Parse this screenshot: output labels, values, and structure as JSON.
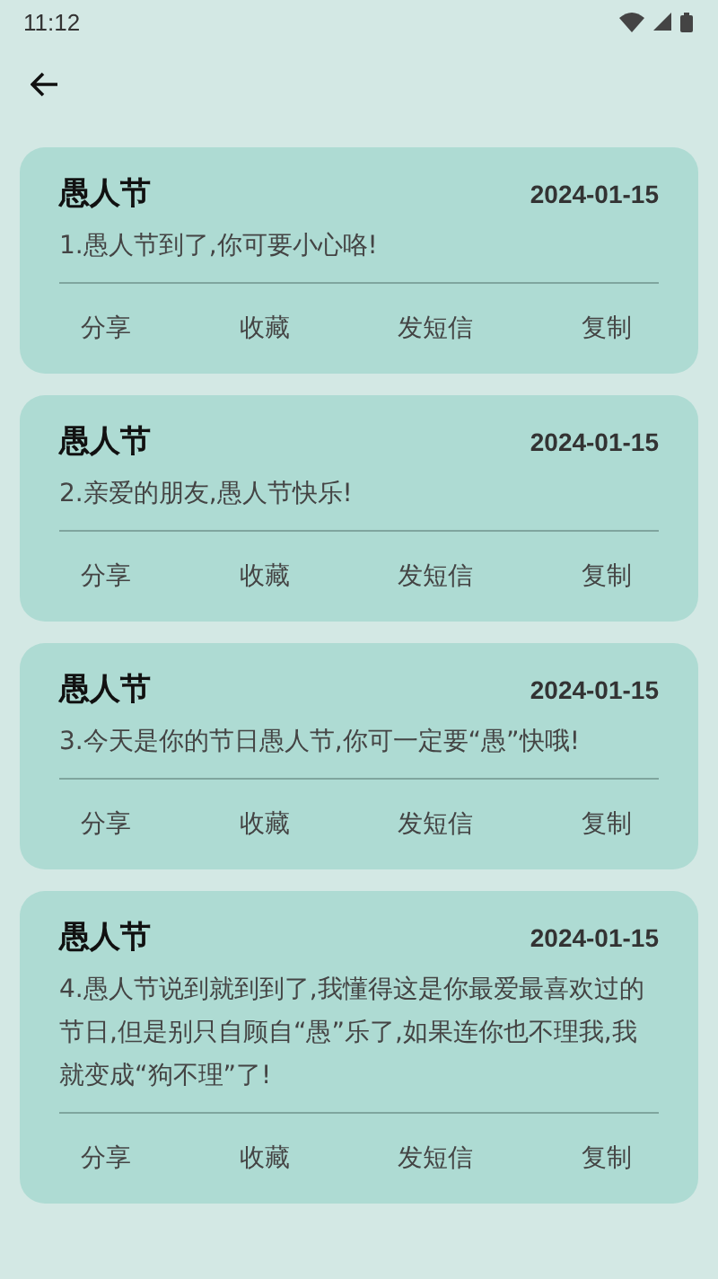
{
  "status_bar": {
    "time": "11:12"
  },
  "cards": [
    {
      "title": "愚人节",
      "date": "2024-01-15",
      "text": "1.愚人节到了,你可要小心咯!",
      "actions": [
        "分享",
        "收藏",
        "发短信",
        "复制"
      ]
    },
    {
      "title": "愚人节",
      "date": "2024-01-15",
      "text": "2.亲爱的朋友,愚人节快乐!",
      "actions": [
        "分享",
        "收藏",
        "发短信",
        "复制"
      ]
    },
    {
      "title": "愚人节",
      "date": "2024-01-15",
      "text": "3.今天是你的节日愚人节,你可一定要“愚”快哦!",
      "actions": [
        "分享",
        "收藏",
        "发短信",
        "复制"
      ]
    },
    {
      "title": "愚人节",
      "date": "2024-01-15",
      "text": "4.愚人节说到就到到了,我懂得这是你最爱最喜欢过的节日,但是别只自顾自“愚”乐了,如果连你也不理我,我就变成“狗不理”了!",
      "actions": [
        "分享",
        "收藏",
        "发短信",
        "复制"
      ]
    }
  ]
}
